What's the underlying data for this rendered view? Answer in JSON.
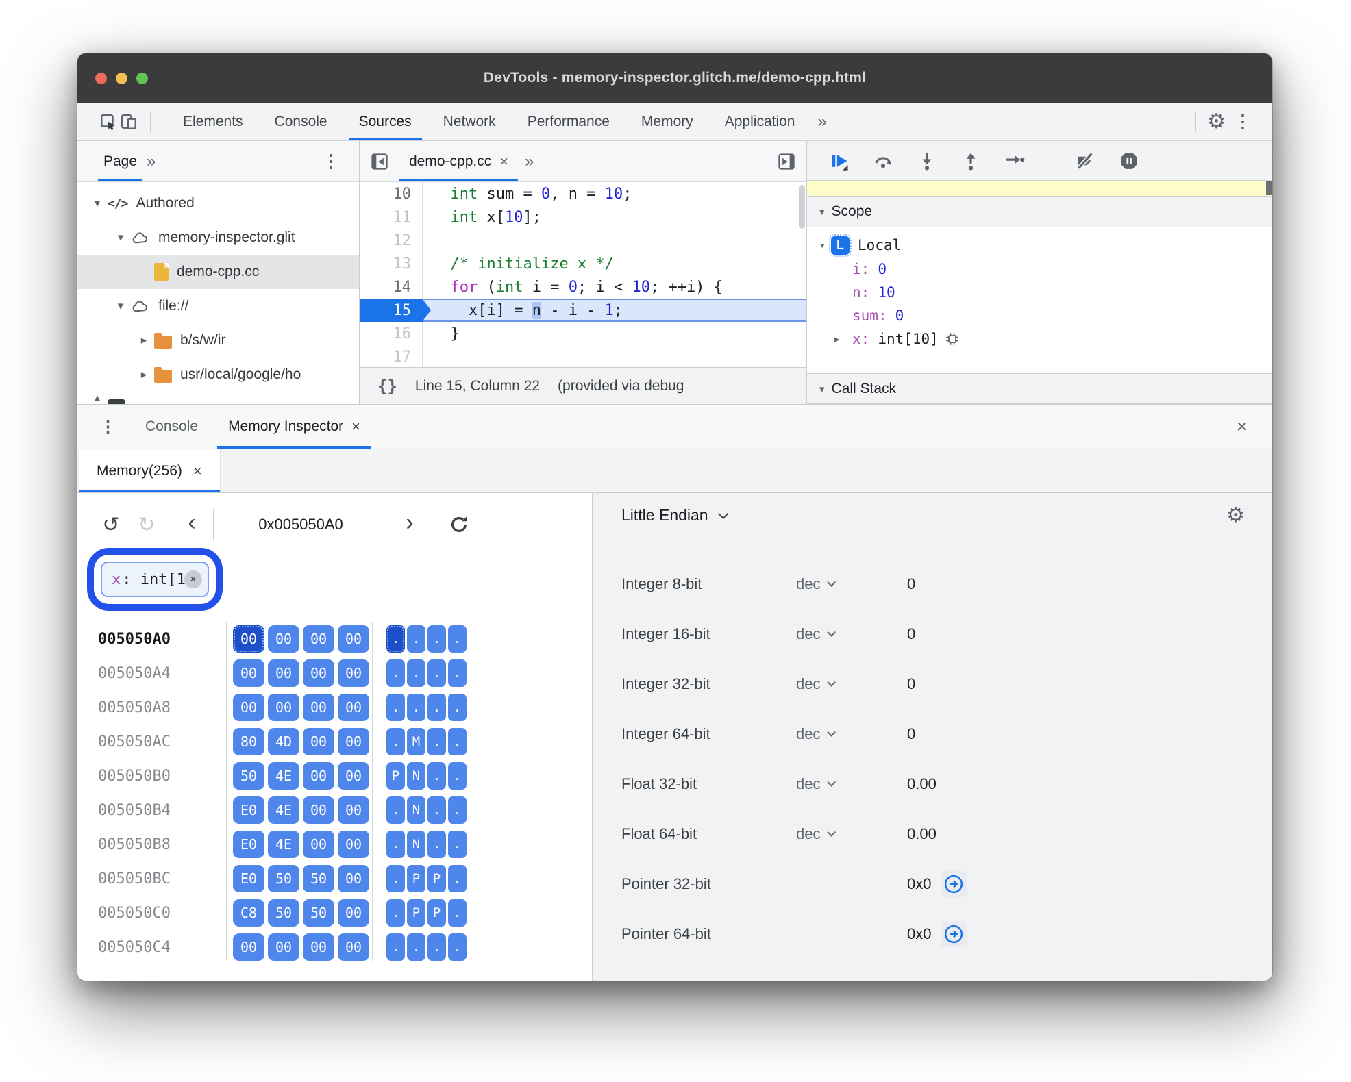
{
  "window": {
    "title": "DevTools - memory-inspector.glitch.me/demo-cpp.html"
  },
  "toolbar": {
    "tabs": [
      "Elements",
      "Console",
      "Sources",
      "Network",
      "Performance",
      "Memory",
      "Application"
    ],
    "active_tab": "Sources",
    "overflow": "»",
    "gear": "⚙",
    "menu": "⋮"
  },
  "navigator": {
    "tab": "Page",
    "overflow": "»",
    "menu": "⋮",
    "tree": [
      {
        "key": "authored",
        "label": "Authored",
        "icon": "code",
        "expander": "▾",
        "depth": 0
      },
      {
        "key": "memory-inspector-glitch",
        "label": "memory-inspector.glit",
        "icon": "cloud",
        "expander": "▾",
        "depth": 1
      },
      {
        "key": "demo-cpp-cc",
        "label": "demo-cpp.cc",
        "icon": "file",
        "expander": "",
        "depth": 2,
        "selected": true
      },
      {
        "key": "file-protocol",
        "label": "file://",
        "icon": "cloud",
        "expander": "▾",
        "depth": 1
      },
      {
        "key": "b-s-w-ir",
        "label": "b/s/w/ir",
        "icon": "folder",
        "expander": "▸",
        "depth": 2
      },
      {
        "key": "usr-local-google",
        "label": "usr/local/google/ho",
        "icon": "folder",
        "expander": "▸",
        "depth": 2
      }
    ]
  },
  "editor": {
    "tab": "demo-cpp.cc",
    "tab_close": "×",
    "overflow": "»",
    "lines": [
      {
        "no": "10",
        "dim": false,
        "tokens": [
          {
            "t": "  "
          },
          {
            "t": "int",
            "c": "g"
          },
          {
            "t": " sum = "
          },
          {
            "t": "0",
            "c": "b"
          },
          {
            "t": ", n = "
          },
          {
            "t": "10",
            "c": "b"
          },
          {
            "t": ";"
          }
        ]
      },
      {
        "no": "11",
        "dim": true,
        "tokens": [
          {
            "t": "  "
          },
          {
            "t": "int",
            "c": "g"
          },
          {
            "t": " x["
          },
          {
            "t": "10",
            "c": "b"
          },
          {
            "t": "];"
          }
        ]
      },
      {
        "no": "12",
        "dim": true,
        "tokens": []
      },
      {
        "no": "13",
        "dim": true,
        "tokens": [
          {
            "t": "  "
          },
          {
            "t": "/* initialize x */",
            "c": "g"
          }
        ]
      },
      {
        "no": "14",
        "dim": false,
        "tokens": [
          {
            "t": "  "
          },
          {
            "t": "for",
            "c": "m"
          },
          {
            "t": " ("
          },
          {
            "t": "int",
            "c": "g"
          },
          {
            "t": " i = "
          },
          {
            "t": "0",
            "c": "b"
          },
          {
            "t": "; i < "
          },
          {
            "t": "10",
            "c": "b"
          },
          {
            "t": "; ++i) {"
          }
        ]
      },
      {
        "no": "15",
        "dim": false,
        "active": true,
        "tokens": [
          {
            "t": "    x[i] = "
          },
          {
            "t": "n",
            "c": "x"
          },
          {
            "t": " - i - "
          },
          {
            "t": "1",
            "c": "b"
          },
          {
            "t": ";"
          }
        ]
      },
      {
        "no": "16",
        "dim": true,
        "tokens": [
          {
            "t": "  }"
          }
        ]
      },
      {
        "no": "17",
        "dim": true,
        "tokens": []
      }
    ],
    "status": {
      "braces": "{}",
      "position": "Line 15, Column 22",
      "origin": "(provided via debug"
    }
  },
  "debugger": {
    "scope_title": "Scope",
    "local_badge": "L",
    "local_label": "Local",
    "vars": [
      {
        "name": "i",
        "value": "0",
        "vclass": "vnum"
      },
      {
        "name": "n",
        "value": "10",
        "vclass": "vnum"
      },
      {
        "name": "sum",
        "value": "0",
        "vclass": "vnum"
      },
      {
        "name": "x",
        "value": "int[10]",
        "vclass": "vtype",
        "arrow": "▸",
        "chip": true
      }
    ],
    "callstack_title": "Call Stack"
  },
  "drawer": {
    "menu": "⋮",
    "tabs": [
      {
        "label": "Console",
        "active": false,
        "closable": false
      },
      {
        "label": "Memory Inspector",
        "active": true,
        "closable": true,
        "close": "×"
      }
    ],
    "close": "×"
  },
  "memory": {
    "tab_label": "Memory(256)",
    "tab_close": "×",
    "toolbar": {
      "undo": "↺",
      "redo": "↻",
      "back": "‹",
      "address": "0x005050A0",
      "forward": "›"
    },
    "tag": {
      "name": "x",
      "rest": ": int[1",
      "close": "×"
    },
    "grid": {
      "rows": [
        {
          "addr": "005050A0",
          "bytes": [
            "00",
            "00",
            "00",
            "00"
          ],
          "ascii": [
            ".",
            ".",
            ".",
            "."
          ],
          "active": true,
          "sel": 0
        },
        {
          "addr": "005050A4",
          "bytes": [
            "00",
            "00",
            "00",
            "00"
          ],
          "ascii": [
            ".",
            ".",
            ".",
            "."
          ]
        },
        {
          "addr": "005050A8",
          "bytes": [
            "00",
            "00",
            "00",
            "00"
          ],
          "ascii": [
            ".",
            ".",
            ".",
            "."
          ]
        },
        {
          "addr": "005050AC",
          "bytes": [
            "80",
            "4D",
            "00",
            "00"
          ],
          "ascii": [
            ".",
            "M",
            ".",
            "."
          ]
        },
        {
          "addr": "005050B0",
          "bytes": [
            "50",
            "4E",
            "00",
            "00"
          ],
          "ascii": [
            "P",
            "N",
            ".",
            "."
          ]
        },
        {
          "addr": "005050B4",
          "bytes": [
            "E0",
            "4E",
            "00",
            "00"
          ],
          "ascii": [
            ".",
            "N",
            ".",
            "."
          ]
        },
        {
          "addr": "005050B8",
          "bytes": [
            "E0",
            "4E",
            "00",
            "00"
          ],
          "ascii": [
            ".",
            "N",
            ".",
            "."
          ]
        },
        {
          "addr": "005050BC",
          "bytes": [
            "E0",
            "50",
            "50",
            "00"
          ],
          "ascii": [
            ".",
            "P",
            "P",
            "."
          ]
        },
        {
          "addr": "005050C0",
          "bytes": [
            "C8",
            "50",
            "50",
            "00"
          ],
          "ascii": [
            ".",
            "P",
            "P",
            "."
          ]
        },
        {
          "addr": "005050C4",
          "bytes": [
            "00",
            "00",
            "00",
            "00"
          ],
          "ascii": [
            ".",
            ".",
            ".",
            "."
          ]
        }
      ]
    },
    "endianness": "Little Endian",
    "gear": "⚙",
    "values": [
      {
        "label": "Integer 8-bit",
        "mode": "dec",
        "value": "0"
      },
      {
        "label": "Integer 16-bit",
        "mode": "dec",
        "value": "0"
      },
      {
        "label": "Integer 32-bit",
        "mode": "dec",
        "value": "0"
      },
      {
        "label": "Integer 64-bit",
        "mode": "dec",
        "value": "0"
      },
      {
        "label": "Float 32-bit",
        "mode": "dec",
        "value": "0.00"
      },
      {
        "label": "Float 64-bit",
        "mode": "dec",
        "value": "0.00"
      },
      {
        "label": "Pointer 32-bit",
        "mode": null,
        "value": "0x0",
        "pointer": true
      },
      {
        "label": "Pointer 64-bit",
        "mode": null,
        "value": "0x0",
        "pointer": true
      }
    ]
  },
  "colors": {
    "accent_blue": "#1a73e8",
    "byte_highlight": "#4e86ec",
    "byte_selected": "#1d50c8",
    "annotation_ring": "#2350e8",
    "paused_bar": "#fdfdc8",
    "keyword_green": "#1b7d32",
    "number_blue": "#2323d6",
    "flow_magenta": "#b02cbc",
    "var_purple": "#a84fb0"
  }
}
